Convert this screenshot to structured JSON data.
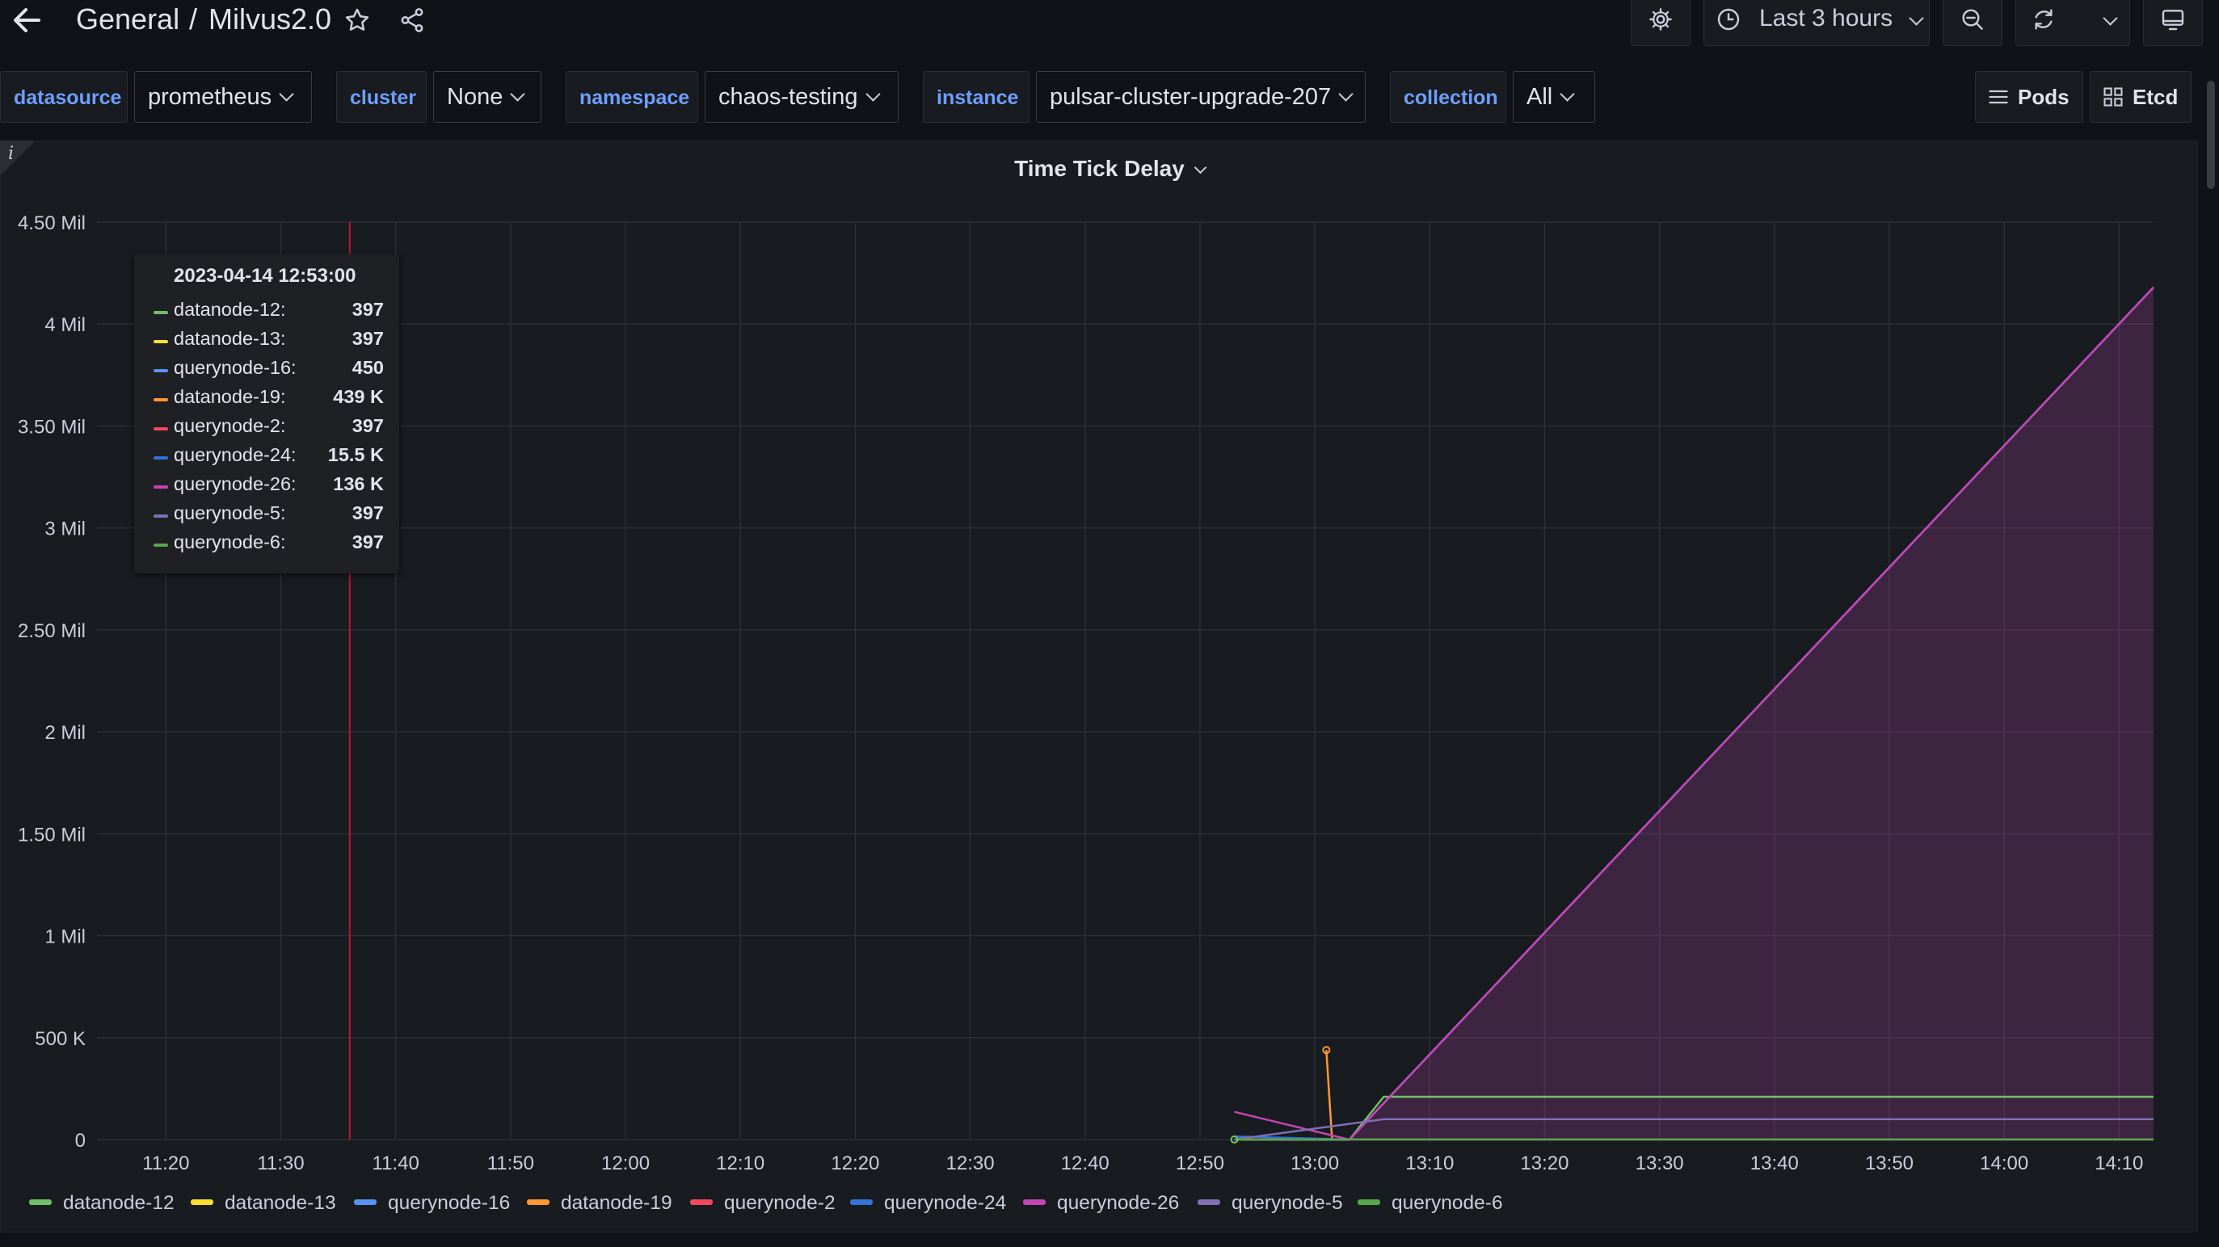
{
  "header": {
    "breadcrumb_folder": "General",
    "breadcrumb_sep": "/",
    "dashboard_title": "Milvus2.0",
    "time_range": "Last 3 hours"
  },
  "variables": [
    {
      "label": "datasource",
      "value": "prometheus"
    },
    {
      "label": "cluster",
      "value": "None"
    },
    {
      "label": "namespace",
      "value": "chaos-testing"
    },
    {
      "label": "instance",
      "value": "pulsar-cluster-upgrade-207"
    },
    {
      "label": "collection",
      "value": "All"
    }
  ],
  "links": {
    "pods": "Pods",
    "etcd": "Etcd"
  },
  "panel": {
    "info": "i",
    "title": "Time Tick Delay"
  },
  "tooltip": {
    "time": "2023-04-14 12:53:00",
    "rows": [
      {
        "name": "datanode-12:",
        "value": "397",
        "color": "#73bf69"
      },
      {
        "name": "datanode-13:",
        "value": "397",
        "color": "#fade2a"
      },
      {
        "name": "querynode-16:",
        "value": "450",
        "color": "#5794f2"
      },
      {
        "name": "datanode-19:",
        "value": "439 K",
        "color": "#ff9830"
      },
      {
        "name": "querynode-2:",
        "value": "397",
        "color": "#f2495c"
      },
      {
        "name": "querynode-24:",
        "value": "15.5 K",
        "color": "#3274d9"
      },
      {
        "name": "querynode-26:",
        "value": "136 K",
        "color": "#c544b6"
      },
      {
        "name": "querynode-5:",
        "value": "397",
        "color": "#806eb7"
      },
      {
        "name": "querynode-6:",
        "value": "397",
        "color": "#56a64b"
      }
    ]
  },
  "chart_data": {
    "type": "line",
    "title": "Time Tick Delay",
    "y_ticks": [
      "0",
      "500 K",
      "1 Mil",
      "1.50 Mil",
      "2 Mil",
      "2.50 Mil",
      "3 Mil",
      "3.50 Mil",
      "4 Mil",
      "4.50 Mil"
    ],
    "x_ticks": [
      "11:20",
      "11:30",
      "11:40",
      "11:50",
      "12:00",
      "12:10",
      "12:20",
      "12:30",
      "12:40",
      "12:50",
      "13:00",
      "13:10",
      "13:20",
      "13:30",
      "13:40",
      "13:50",
      "14:00",
      "14:10"
    ],
    "ylim": [
      0,
      4500000
    ],
    "xlim_minutes": [
      "11:14",
      "14:13"
    ],
    "grid": true,
    "legend_placement": "bottom",
    "hover_time": "11:36",
    "series": [
      {
        "name": "datanode-12",
        "color": "#73bf69",
        "points": [
          [
            "12:53",
            397
          ],
          [
            "13:03",
            0
          ],
          [
            "13:06",
            210000
          ],
          [
            "14:13",
            210000
          ]
        ]
      },
      {
        "name": "datanode-13",
        "color": "#fade2a",
        "points": [
          [
            "12:53",
            397
          ],
          [
            "13:03",
            0
          ],
          [
            "14:13",
            4180000
          ]
        ]
      },
      {
        "name": "querynode-16",
        "color": "#5794f2",
        "points": [
          [
            "12:53",
            450
          ],
          [
            "13:03",
            0
          ],
          [
            "14:13",
            4180000
          ]
        ]
      },
      {
        "name": "datanode-19",
        "color": "#ff9830",
        "points": [
          [
            "13:01",
            439000
          ],
          [
            "13:01.5",
            0
          ]
        ]
      },
      {
        "name": "querynode-2",
        "color": "#f2495c",
        "points": [
          [
            "12:53",
            397
          ],
          [
            "14:13",
            397
          ]
        ]
      },
      {
        "name": "querynode-24",
        "color": "#3274d9",
        "points": [
          [
            "12:53",
            15500
          ],
          [
            "13:03",
            0
          ],
          [
            "14:13",
            4180000
          ]
        ]
      },
      {
        "name": "querynode-26",
        "color": "#c544b6",
        "points": [
          [
            "12:53",
            136000
          ],
          [
            "13:03",
            0
          ],
          [
            "14:13",
            4180000
          ]
        ]
      },
      {
        "name": "querynode-5",
        "color": "#806eb7",
        "points": [
          [
            "12:53",
            397
          ],
          [
            "13:06",
            100000
          ],
          [
            "14:13",
            100000
          ]
        ]
      },
      {
        "name": "querynode-6",
        "color": "#56a64b",
        "points": [
          [
            "12:53",
            397
          ],
          [
            "14:13",
            397
          ]
        ]
      }
    ]
  }
}
